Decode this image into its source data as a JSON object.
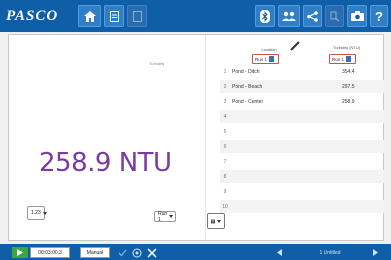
{
  "app": {
    "logo_text": "PASCO",
    "toolbar": {
      "home_icon": "home-icon",
      "doc_icon": "document-icon",
      "doc2_icon": "document-icon",
      "bluetooth_icon": "bluetooth-icon",
      "people_icon": "people-icon",
      "share_icon": "share-icon",
      "tool_icon": "tool-icon",
      "camera_icon": "camera-icon",
      "help_label": "?"
    }
  },
  "display": {
    "label": "Turbidity",
    "value": "258.9 NTU",
    "scale_button": "1.23",
    "run_select": "Run 1"
  },
  "table": {
    "col1_header": "Location",
    "col2_header": "Turbidity (NTU)",
    "col1_run": "Run 1",
    "col2_run": "Run 1",
    "rows": [
      {
        "num": "1",
        "location": "Pond - Ditch",
        "value": "354.4"
      },
      {
        "num": "2",
        "location": "Pond - Beach",
        "value": "297.5"
      },
      {
        "num": "3",
        "location": "Pond - Center",
        "value": "258.9"
      },
      {
        "num": "4",
        "location": "",
        "value": ""
      },
      {
        "num": "5",
        "location": "",
        "value": ""
      },
      {
        "num": "6",
        "location": "",
        "value": ""
      },
      {
        "num": "7",
        "location": "",
        "value": ""
      },
      {
        "num": "8",
        "location": "",
        "value": ""
      },
      {
        "num": "9",
        "location": "",
        "value": ""
      },
      {
        "num": "10",
        "location": "",
        "value": ""
      }
    ]
  },
  "bottombar": {
    "timer": "00:03:00.3",
    "mode": "Manual",
    "page_label": "1 Untitled"
  }
}
